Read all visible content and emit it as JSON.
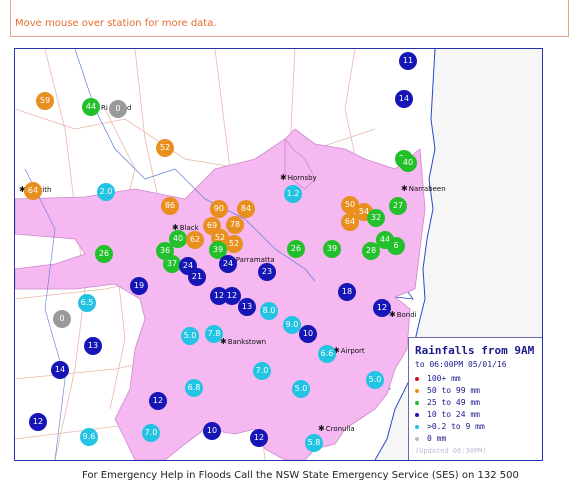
{
  "hint": "Move mouse over station for more data.",
  "legend": {
    "title": "Rainfalls from 9AM",
    "subtitle": "to 06:00PM 05/01/16",
    "rows": [
      {
        "label": "100+ mm",
        "color": "#d11111"
      },
      {
        "label": "50  to 99 mm",
        "color": "#e88f1f"
      },
      {
        "label": "25  to 49 mm",
        "color": "#22c02a"
      },
      {
        "label": "10  to 24 mm",
        "color": "#1616b6"
      },
      {
        "label": ">0.2 to 9 mm",
        "color": "#22c3e3"
      },
      {
        "label": "0 mm",
        "color": "#bbbbbb"
      }
    ],
    "updated": "(Updated 06:30PM)"
  },
  "places": {
    "penrith": "Penrith",
    "richmond": "Ri",
    "richmond2": "d",
    "hornsby": "Hornsby",
    "narrabeen": "Narrabeen",
    "blacktown": "Black",
    "parramatta": "Parramatta",
    "bondi": "Bondi",
    "bankstown": "Bankstown",
    "airport": "Airport",
    "cronulla": "Cronulla"
  },
  "stations": [
    {
      "v": "11",
      "c": "blue"
    },
    {
      "v": "59",
      "c": "orange"
    },
    {
      "v": "44",
      "c": "green"
    },
    {
      "v": "0",
      "c": "grey"
    },
    {
      "v": "14",
      "c": "blue"
    },
    {
      "v": "52",
      "c": "orange"
    },
    {
      "v": "20",
      "c": "green"
    },
    {
      "v": "40",
      "c": "green"
    },
    {
      "v": "64",
      "c": "orange"
    },
    {
      "v": "2.0",
      "c": "cyan"
    },
    {
      "v": "1.2",
      "c": "cyan"
    },
    {
      "v": "86",
      "c": "orange"
    },
    {
      "v": "90",
      "c": "orange"
    },
    {
      "v": "84",
      "c": "orange"
    },
    {
      "v": "50",
      "c": "orange"
    },
    {
      "v": "54",
      "c": "orange"
    },
    {
      "v": "27",
      "c": "green"
    },
    {
      "v": "64",
      "c": "orange"
    },
    {
      "v": "32",
      "c": "green"
    },
    {
      "v": "69",
      "c": "orange"
    },
    {
      "v": "78",
      "c": "orange"
    },
    {
      "v": "52",
      "c": "orange"
    },
    {
      "v": "40",
      "c": "green"
    },
    {
      "v": "62",
      "c": "orange"
    },
    {
      "v": "52",
      "c": "orange"
    },
    {
      "v": "44",
      "c": "green"
    },
    {
      "v": "6",
      "c": "green"
    },
    {
      "v": "26",
      "c": "green"
    },
    {
      "v": "36",
      "c": "green"
    },
    {
      "v": "39",
      "c": "green"
    },
    {
      "v": "26",
      "c": "green"
    },
    {
      "v": "39",
      "c": "green"
    },
    {
      "v": "28",
      "c": "green"
    },
    {
      "v": "37",
      "c": "green"
    },
    {
      "v": "24",
      "c": "blue"
    },
    {
      "v": "24",
      "c": "blue"
    },
    {
      "v": "21",
      "c": "blue"
    },
    {
      "v": "23",
      "c": "blue"
    },
    {
      "v": "19",
      "c": "blue"
    },
    {
      "v": "18",
      "c": "blue"
    },
    {
      "v": "6.5",
      "c": "cyan"
    },
    {
      "v": "12",
      "c": "blue"
    },
    {
      "v": "12",
      "c": "blue"
    },
    {
      "v": "13",
      "c": "blue"
    },
    {
      "v": "8.0",
      "c": "cyan"
    },
    {
      "v": "12",
      "c": "blue"
    },
    {
      "v": "0",
      "c": "grey"
    },
    {
      "v": "9.0",
      "c": "cyan"
    },
    {
      "v": "10",
      "c": "blue"
    },
    {
      "v": "5.0",
      "c": "cyan"
    },
    {
      "v": "7.8",
      "c": "cyan"
    },
    {
      "v": "13",
      "c": "blue"
    },
    {
      "v": "6.6",
      "c": "cyan"
    },
    {
      "v": "14",
      "c": "blue"
    },
    {
      "v": "7.0",
      "c": "cyan"
    },
    {
      "v": "5.0",
      "c": "cyan"
    },
    {
      "v": "6.8",
      "c": "cyan"
    },
    {
      "v": "5.0",
      "c": "cyan"
    },
    {
      "v": "12",
      "c": "blue"
    },
    {
      "v": "12",
      "c": "blue"
    },
    {
      "v": "7.0",
      "c": "cyan"
    },
    {
      "v": "10",
      "c": "blue"
    },
    {
      "v": "9.6",
      "c": "cyan"
    },
    {
      "v": "12",
      "c": "blue"
    },
    {
      "v": "5.8",
      "c": "cyan"
    }
  ],
  "footer": "For Emergency Help in Floods Call the NSW State Emergency Service (SES) on 132 500"
}
